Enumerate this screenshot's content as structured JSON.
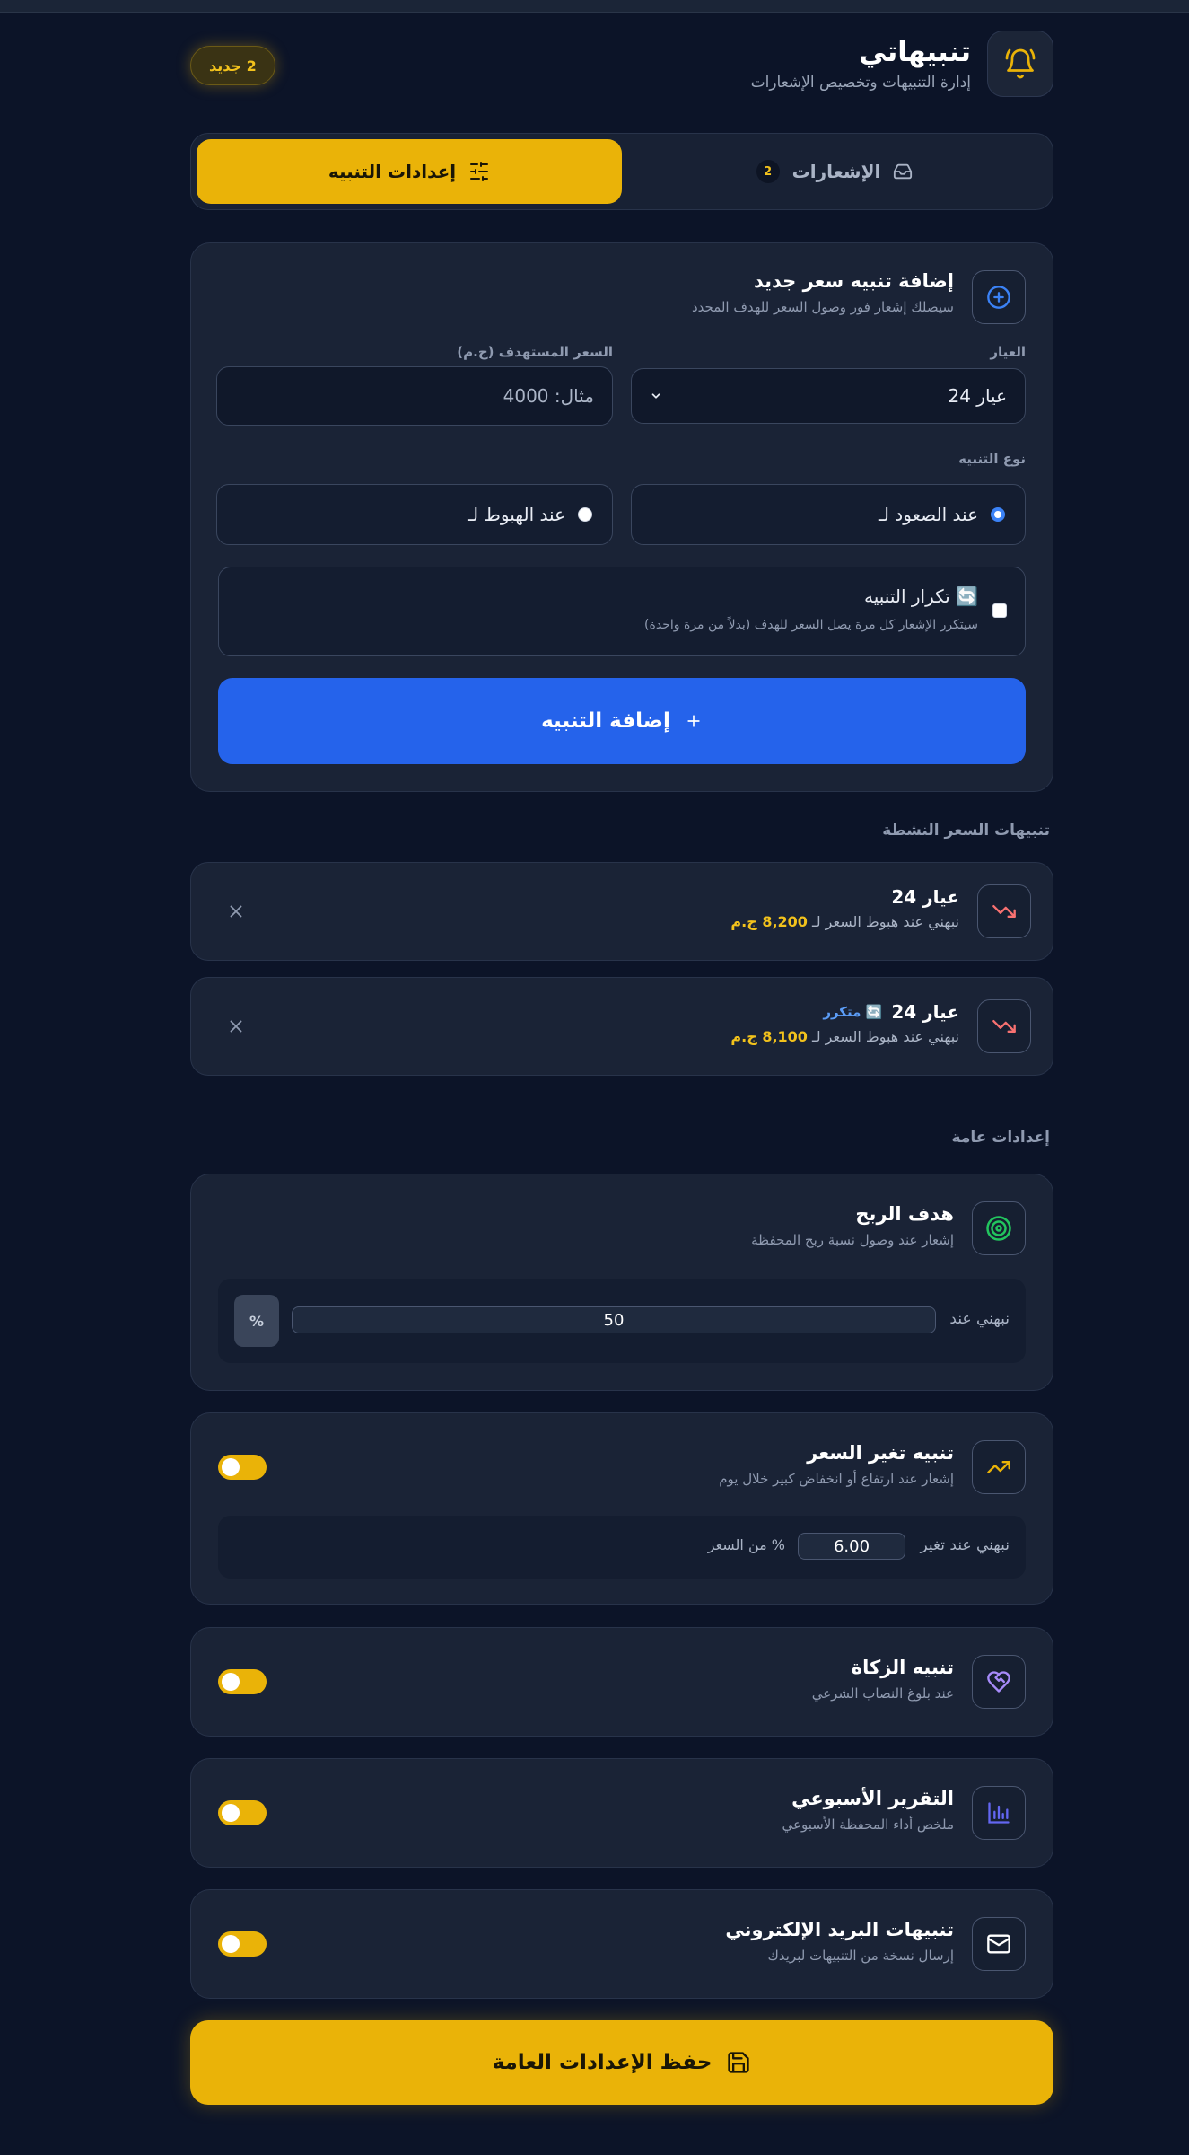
{
  "header": {
    "title": "تنبيهاتي",
    "subtitle": "إدارة التنبيهات وتخصيص الإشعارات",
    "new_badge": "2 جديد"
  },
  "tabs": {
    "notifications_label": "الإشعارات",
    "notifications_count": "2",
    "settings_label": "إعدادات التنبيه"
  },
  "add_alert": {
    "title": "إضافة تنبيه سعر جديد",
    "subtitle": "سيصلك إشعار فور وصول السعر للهدف المحدد",
    "karat_label": "العيار",
    "karat_value": "عيار 24",
    "target_label": "السعر المستهدف (ج.م)",
    "target_placeholder": "مثال: 4000",
    "type_label": "نوع التنبيه",
    "type_up": "عند الصعود لـ",
    "type_down": "عند الهبوط لـ",
    "repeat_title": "🔄 تكرار التنبيه",
    "repeat_sub": "سيتكرر الإشعار كل مرة يصل السعر للهدف (بدلاً من مرة واحدة)",
    "submit_label": "إضافة التنبيه"
  },
  "active_alerts": {
    "section_label": "تنبيهات السعر النشطة",
    "items": [
      {
        "title": "عيار 24",
        "repeat": "",
        "sub_prefix": "نبهني عند هبوط السعر لـ",
        "price": "8,200 ج.م"
      },
      {
        "title": "عيار 24",
        "repeat": "🔄 متكرر",
        "sub_prefix": "نبهني عند هبوط السعر لـ",
        "price": "8,100 ج.م"
      }
    ]
  },
  "general": {
    "section_label": "إعدادات عامة",
    "profit": {
      "title": "هدف الربح",
      "subtitle": "إشعار عند وصول نسبة ربح المحفظة",
      "notify_label": "نبهني عند",
      "value": "50",
      "unit": "%"
    },
    "price_change": {
      "title": "تنبيه تغير السعر",
      "subtitle": "إشعار عند ارتفاع أو انخفاض كبير خلال يوم",
      "notify_label": "نبهني عند تغير",
      "value": "6.00",
      "suffix": "% من السعر"
    },
    "zakat": {
      "title": "تنبيه الزكاة",
      "subtitle": "عند بلوغ النصاب الشرعي"
    },
    "weekly": {
      "title": "التقرير الأسبوعي",
      "subtitle": "ملخص أداء المحفظة الأسبوعي"
    },
    "email": {
      "title": "تنبيهات البريد الإلكتروني",
      "subtitle": "إرسال نسخة من التنبيهات لبريدك"
    },
    "save_label": "حفظ الإعدادات العامة"
  },
  "colors": {
    "accent": "#eab308",
    "primary": "#2563eb",
    "background": "#0c1428",
    "card": "#1a2336"
  }
}
